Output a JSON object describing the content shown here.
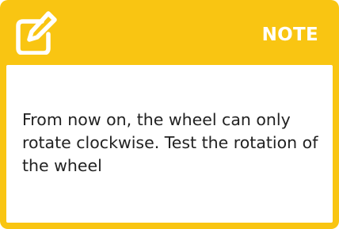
{
  "note": {
    "title": "NOTE",
    "icon": "edit-icon",
    "text": "From now on, the wheel can only rotate clockwise. Test the rotation of the wheel"
  },
  "colors": {
    "accent": "#f9c512",
    "title": "#ffffff",
    "body_background": "#ffffff",
    "text": "#222222"
  }
}
